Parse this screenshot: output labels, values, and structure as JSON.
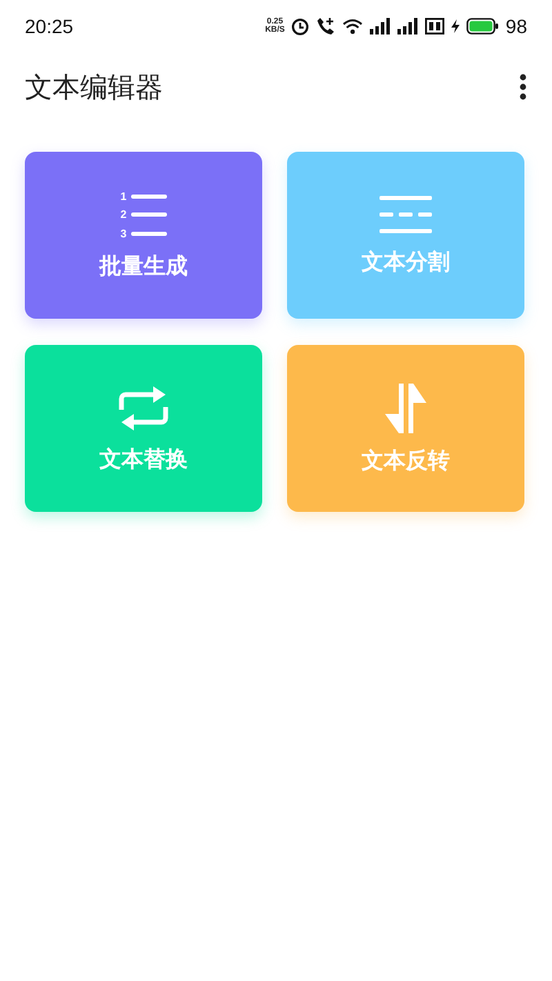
{
  "status_bar": {
    "time": "20:25",
    "net_speed": [
      "0.25",
      "KB/S"
    ],
    "battery": "98"
  },
  "app_bar": {
    "title": "文本编辑器"
  },
  "cards": [
    {
      "kind": "numbered",
      "label": "批量生成",
      "color": "#7b70f7",
      "numbers": [
        "1",
        "2",
        "3"
      ]
    },
    {
      "kind": "split",
      "label": "文本分割",
      "color": "#6dcdfc"
    },
    {
      "kind": "replace",
      "label": "文本替换",
      "color": "#0be09c"
    },
    {
      "kind": "reverse",
      "label": "文本反转",
      "color": "#fdb94b"
    }
  ]
}
